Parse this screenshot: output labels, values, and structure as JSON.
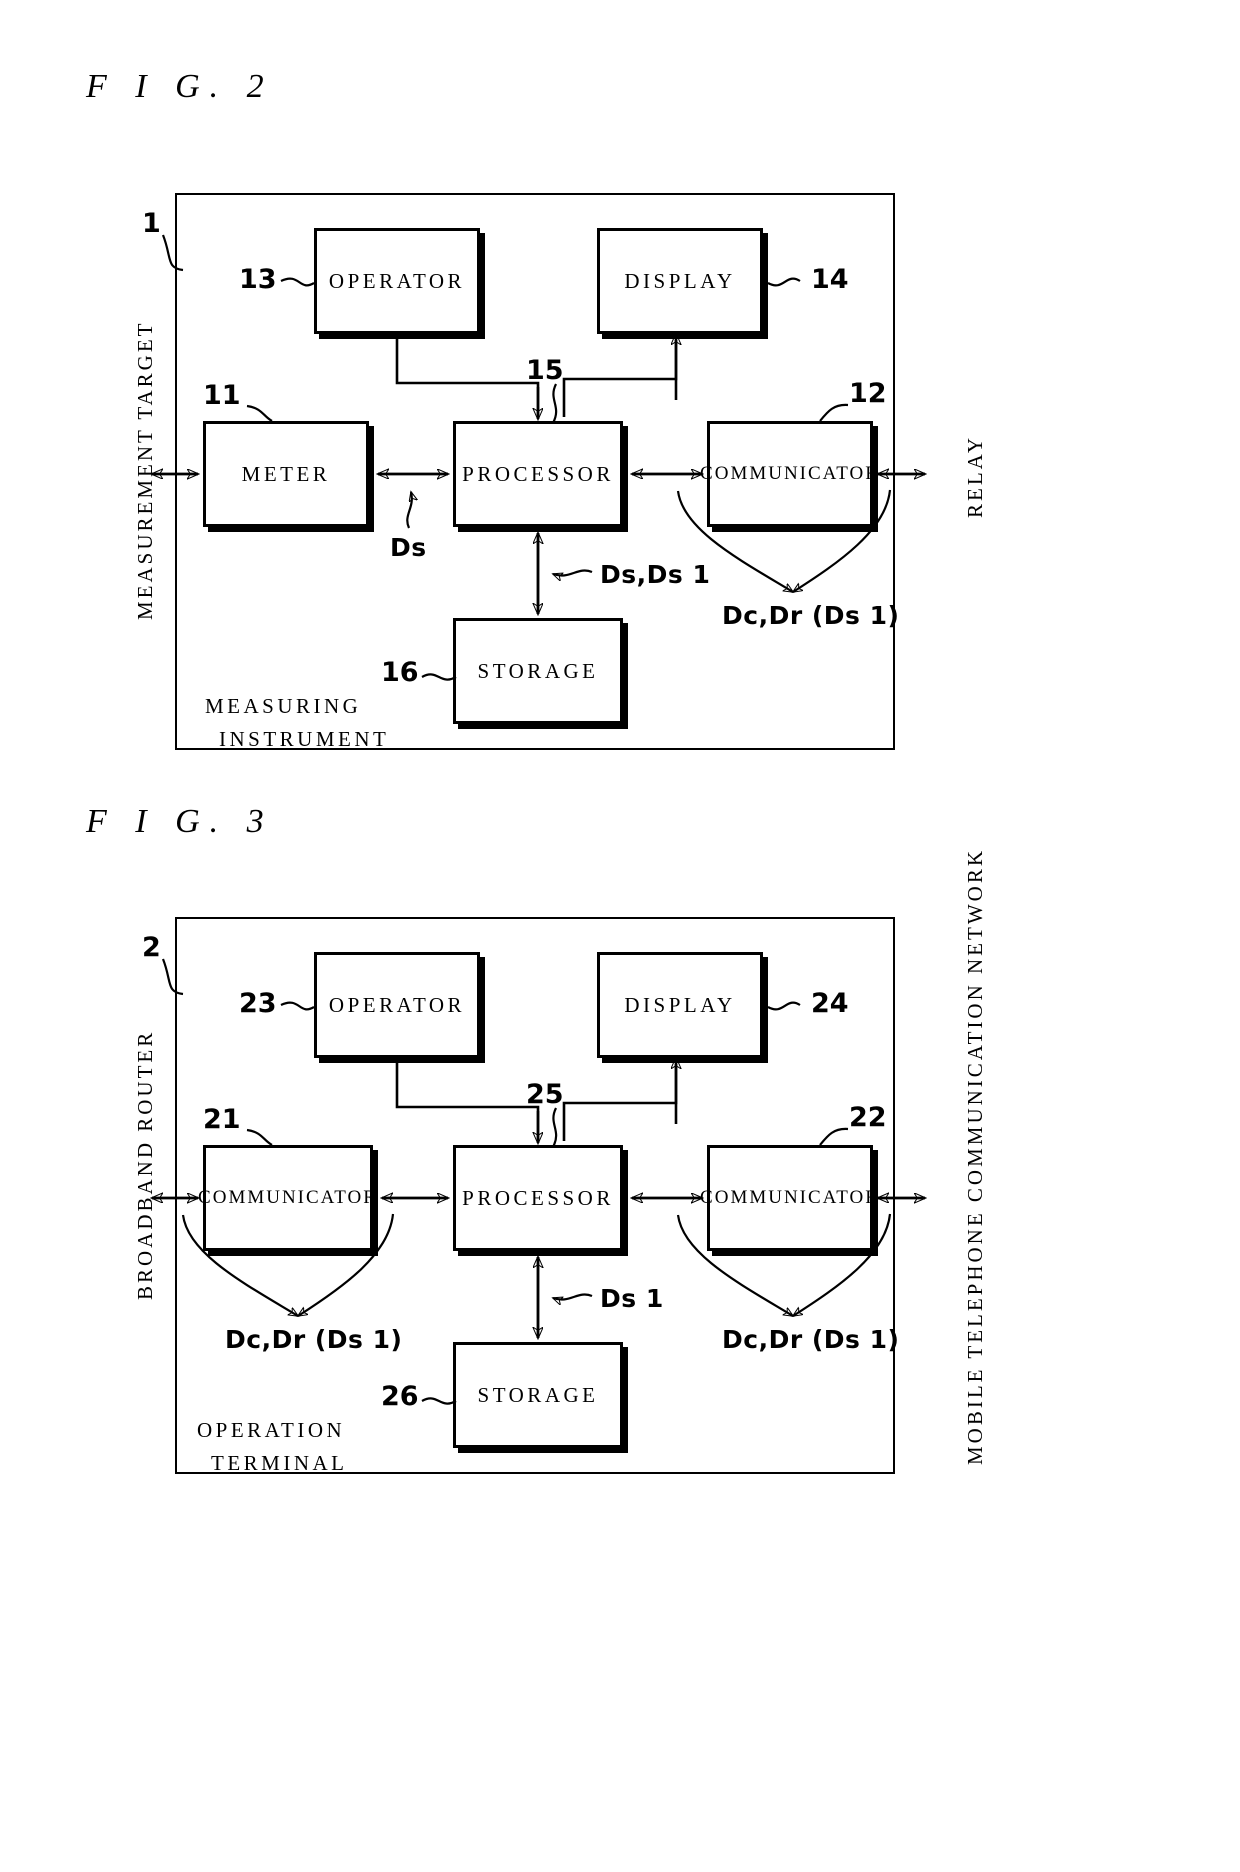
{
  "figures": [
    {
      "title": "F I G. 2",
      "panel_ref": "1",
      "panel_name_line1": "MEASURING",
      "panel_name_line2": "INSTRUMENT",
      "left_side_label": "MEASUREMENT TARGET",
      "right_side_label": "RELAY",
      "blocks": [
        {
          "id": "operator",
          "label": "OPERATOR",
          "ref": "13"
        },
        {
          "id": "display",
          "label": "DISPLAY",
          "ref": "14"
        },
        {
          "id": "meter",
          "label": "METER",
          "ref": "11"
        },
        {
          "id": "processor",
          "label": "PROCESSOR",
          "ref": "15"
        },
        {
          "id": "communicator",
          "label": "COMMUNICATOR",
          "ref": "12"
        },
        {
          "id": "storage",
          "label": "STORAGE",
          "ref": "16"
        }
      ],
      "signal_labels": [
        {
          "id": "ds",
          "text": "Ds"
        },
        {
          "id": "ds-ds1",
          "text": "Ds,Ds 1"
        },
        {
          "id": "dc-dr",
          "text": "Dc,Dr (Ds 1)"
        }
      ]
    },
    {
      "title": "F I G. 3",
      "panel_ref": "2",
      "panel_name_line1": "OPERATION",
      "panel_name_line2": "TERMINAL",
      "left_side_label": "BROADBAND ROUTER",
      "right_side_label": "MOBILE TELEPHONE COMMUNICATION NETWORK",
      "blocks": [
        {
          "id": "operator",
          "label": "OPERATOR",
          "ref": "23"
        },
        {
          "id": "display",
          "label": "DISPLAY",
          "ref": "24"
        },
        {
          "id": "communicator-left",
          "label": "COMMUNICATOR",
          "ref": "21"
        },
        {
          "id": "processor",
          "label": "PROCESSOR",
          "ref": "25"
        },
        {
          "id": "communicator-right",
          "label": "COMMUNICATOR",
          "ref": "22"
        },
        {
          "id": "storage",
          "label": "STORAGE",
          "ref": "26"
        }
      ],
      "signal_labels": [
        {
          "id": "ds1",
          "text": "Ds 1"
        },
        {
          "id": "dc-dr-left",
          "text": "Dc,Dr (Ds 1)"
        },
        {
          "id": "dc-dr-right",
          "text": "Dc,Dr (Ds 1)"
        }
      ]
    }
  ],
  "colors": {
    "ink": "#000000",
    "paper": "#ffffff"
  }
}
